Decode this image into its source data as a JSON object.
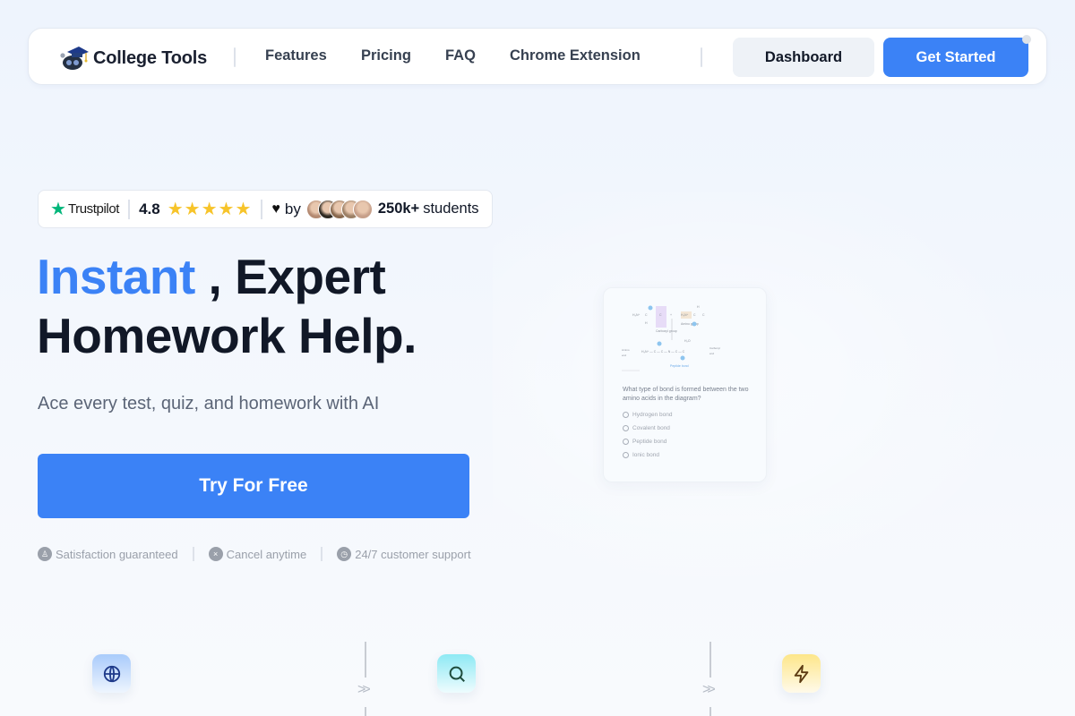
{
  "nav": {
    "brand": "College Tools",
    "links": [
      "Features",
      "Pricing",
      "FAQ",
      "Chrome Extension"
    ],
    "dashboard_label": "Dashboard",
    "get_started_label": "Get Started"
  },
  "trust": {
    "provider": "Trustpilot",
    "rating": "4.8",
    "stars": "★★★★★",
    "star_count": 5,
    "by_label": "by",
    "students_count": "250k+",
    "students_label": "students",
    "avatar_colors": [
      "#b48a72",
      "#2f2a22",
      "#8a6a50",
      "#9c8066",
      "#c7a08a"
    ]
  },
  "hero": {
    "title_accent": "Instant",
    "title_rest_line1": " , Expert",
    "title_line2": "Homework Help.",
    "subtitle": "Ace every test, quiz, and homework with AI",
    "cta_label": "Try For Free",
    "guarantees": [
      {
        "icon": "award-icon",
        "glyph": "♙",
        "label": "Satisfaction guaranteed"
      },
      {
        "icon": "x-circle-icon",
        "glyph": "×",
        "label": "Cancel anytime"
      },
      {
        "icon": "clock-icon",
        "glyph": "◷",
        "label": "24/7 customer support"
      }
    ]
  },
  "preview": {
    "question": "What type of bond is formed between the two amino acids in the diagram?",
    "options": [
      "Hydrogen bond",
      "Covalent bond",
      "Peptide bond",
      "Ionic bond"
    ],
    "diagram_labels": {
      "carboxyl": "Carboxyl group",
      "amino": "Amino group",
      "water": "H₂O",
      "n_terminal": "Amino (N-terminal) end",
      "c_terminal": "Carboxyl (C-terminal) end",
      "peptide": "Peptide bond"
    }
  },
  "features": [
    {
      "icon": "globe-icon"
    },
    {
      "icon": "search-icon"
    },
    {
      "icon": "lightning-icon"
    }
  ],
  "colors": {
    "accent": "#3b82f6",
    "heading": "#111827",
    "muted": "#5b6577",
    "trustpilot": "#00b67a",
    "star": "#f7c42a"
  }
}
